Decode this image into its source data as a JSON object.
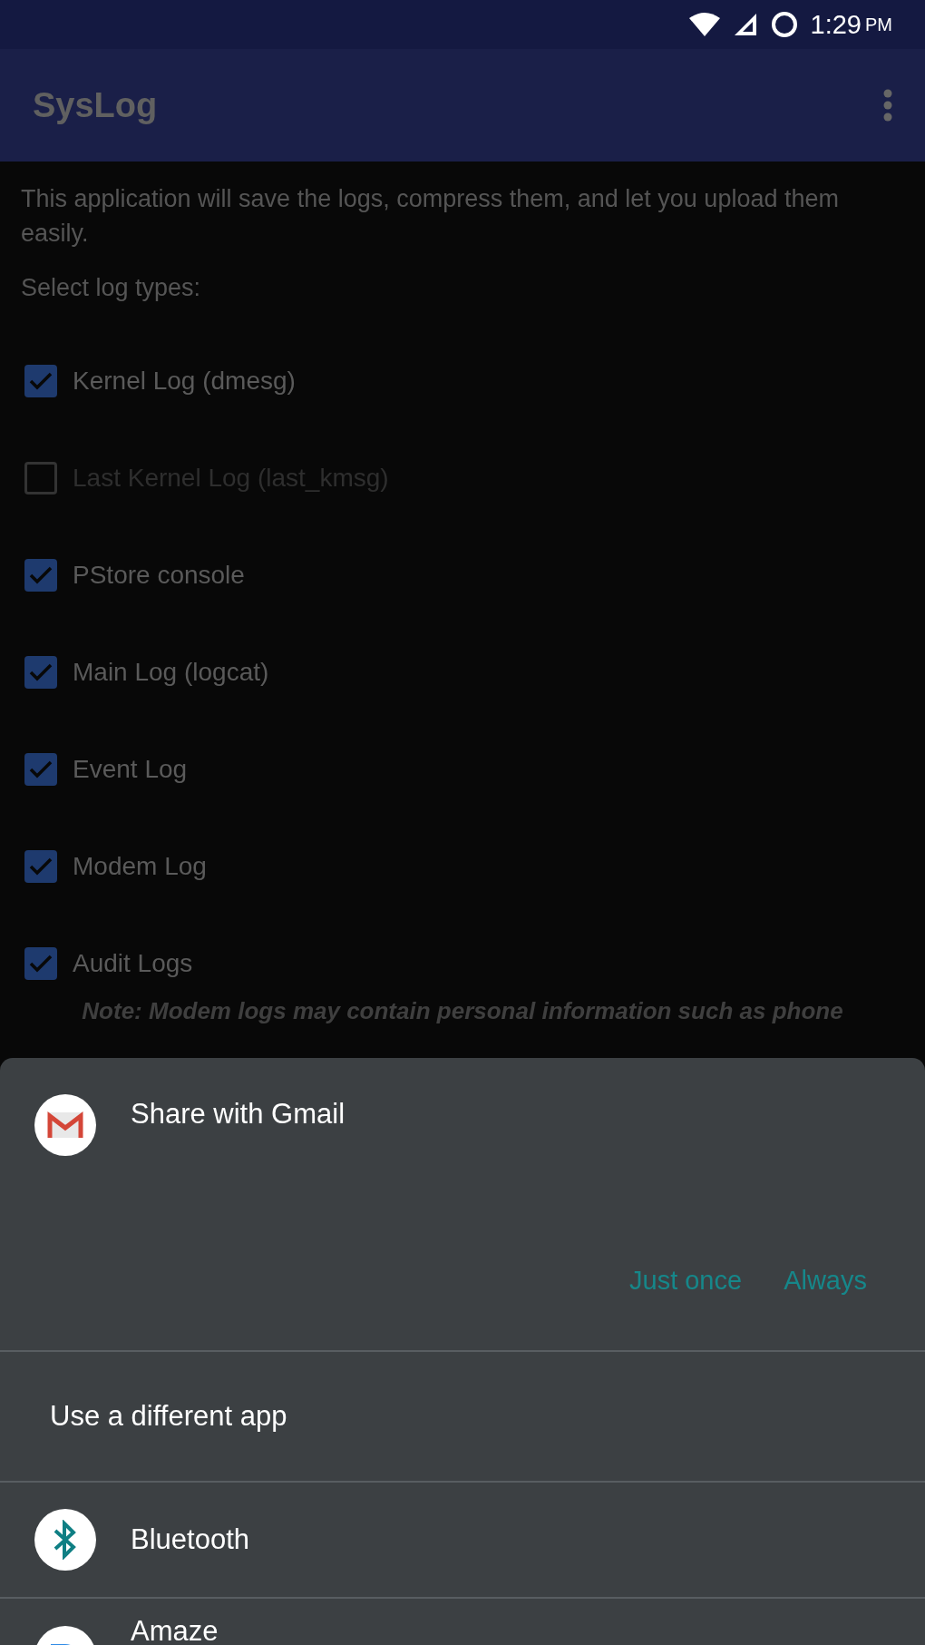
{
  "status_bar": {
    "time": "1:29",
    "period": "PM"
  },
  "app_bar": {
    "title": "SysLog"
  },
  "intro": "This application will save the logs, compress them, and let you upload them easily.",
  "section_label": "Select log types:",
  "log_types": [
    {
      "label": "Kernel Log (dmesg)",
      "checked": true,
      "disabled": false
    },
    {
      "label": "Last Kernel Log (last_kmsg)",
      "checked": false,
      "disabled": true
    },
    {
      "label": "PStore console",
      "checked": true,
      "disabled": false
    },
    {
      "label": "Main Log (logcat)",
      "checked": true,
      "disabled": false
    },
    {
      "label": "Event Log",
      "checked": true,
      "disabled": false
    },
    {
      "label": "Modem Log",
      "checked": true,
      "disabled": false
    },
    {
      "label": "Audit Logs",
      "checked": true,
      "disabled": false
    }
  ],
  "note": "Note: Modem logs may contain personal information such as phone",
  "share_sheet": {
    "title": "Share with Gmail",
    "buttons": [
      "Just once",
      "Always"
    ],
    "other_label": "Use a different app",
    "apps": [
      {
        "name": "Bluetooth",
        "kind": "bluetooth"
      },
      {
        "name": "Amaze",
        "kind": "amaze"
      }
    ]
  }
}
